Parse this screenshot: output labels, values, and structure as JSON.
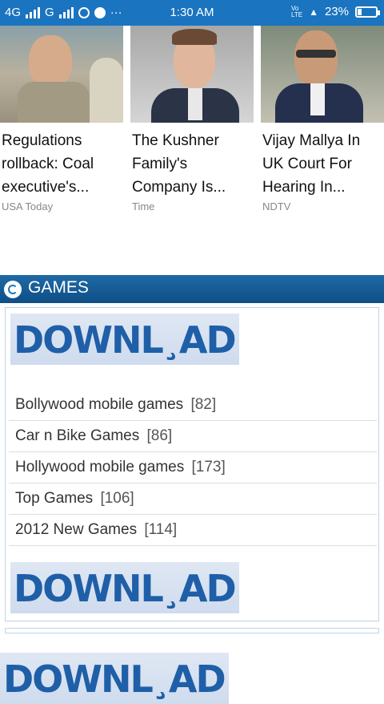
{
  "status_bar": {
    "network1": "4G",
    "network2": "G",
    "time": "1:30 AM",
    "volte": "Vo\nLTE",
    "battery": "23%",
    "battery_fraction": 0.23,
    "ellipsis": "···"
  },
  "news": [
    {
      "title": "Regulations rollback: Coal executive's...",
      "source": "USA Today"
    },
    {
      "title": "The Kushner Family's Company Is...",
      "source": "Time"
    },
    {
      "title": "Vijay Mallya In UK Court For Hearing In...",
      "source": "NDTV"
    }
  ],
  "games": {
    "header": "GAMES",
    "banner_text": "DOWNL¸AD",
    "items": [
      {
        "label": "Bollywood mobile games",
        "count": "[82]"
      },
      {
        "label": "Car n Bike Games",
        "count": "[86]"
      },
      {
        "label": "Hollywood mobile games",
        "count": "[173]"
      },
      {
        "label": "Top Games",
        "count": "[106]"
      },
      {
        "label": "2012 New Games",
        "count": "[114]"
      }
    ]
  },
  "colors": {
    "status_bar": "#1a74c0",
    "header": "#1f6aa6",
    "banner_text": "#1f5fa8"
  }
}
